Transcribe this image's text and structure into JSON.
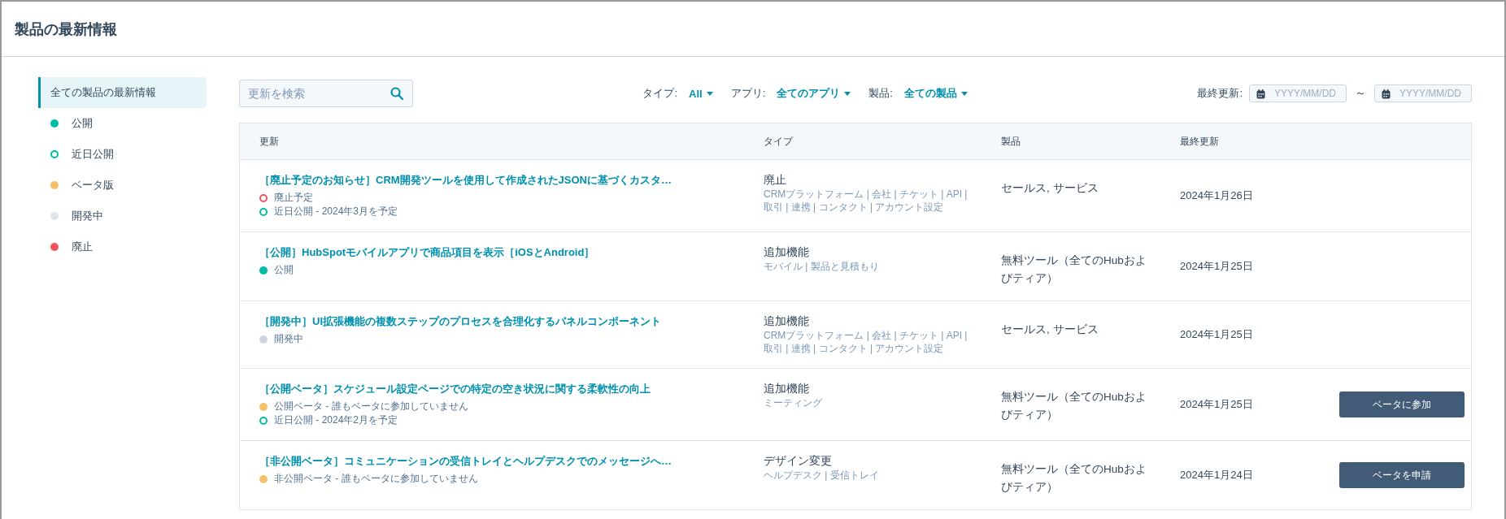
{
  "page": {
    "title": "製品の最新情報"
  },
  "sidebar": {
    "items": [
      {
        "label": "全ての製品の最新情報",
        "kind": "all",
        "selected": true
      },
      {
        "label": "公開",
        "kind": "filled",
        "color": "#00bda5",
        "selected": false
      },
      {
        "label": "近日公開",
        "kind": "ring",
        "color": "#00bda5",
        "selected": false
      },
      {
        "label": "ベータ版",
        "kind": "filled",
        "color": "#f5c26b",
        "selected": false
      },
      {
        "label": "開発中",
        "kind": "filled",
        "color": "#dfe3eb",
        "selected": false
      },
      {
        "label": "廃止",
        "kind": "filled",
        "color": "#f2545b",
        "selected": false
      }
    ]
  },
  "search": {
    "placeholder": "更新を検索"
  },
  "filters": [
    {
      "label": "タイプ:",
      "value": "All"
    },
    {
      "label": "アプリ:",
      "value": "全てのアプリ"
    },
    {
      "label": "製品:",
      "value": "全ての製品"
    }
  ],
  "date_range": {
    "label": "最終更新:",
    "separator": "～",
    "from": {
      "placeholder": "YYYY/MM/DD"
    },
    "to": {
      "placeholder": "YYYY/MM/DD"
    }
  },
  "table": {
    "columns": [
      "更新",
      "タイプ",
      "製品",
      "最終更新"
    ],
    "rows": [
      {
        "title": "［廃止予定のお知らせ］CRM開発ツールを使用して作成されたJSONに基づくカスタ…",
        "statuses": [
          {
            "text": "廃止予定",
            "kind": "ring",
            "color": "#f2545b"
          },
          {
            "text": "近日公開 - 2024年3月を予定",
            "kind": "ring",
            "color": "#00bda5"
          }
        ],
        "type": "廃止",
        "tags": "CRMプラットフォーム | 会社 | チケット | API | 取引 | 連携 | コンタクト | アカウント設定",
        "product": "セールス, サービス",
        "date": "2024年1月26日"
      },
      {
        "title": "［公開］HubSpotモバイルアプリで商品項目を表示［iOSとAndroid］",
        "statuses": [
          {
            "text": "公開",
            "kind": "filled",
            "color": "#00bda5"
          }
        ],
        "type": "追加機能",
        "tags": "モバイル | 製品と見積もり",
        "product": "無料ツール（全てのHubおよびティア）",
        "date": "2024年1月25日"
      },
      {
        "title": "［開発中］UI拡張機能の複数ステップのプロセスを合理化するパネルコンポーネント",
        "statuses": [
          {
            "text": "開発中",
            "kind": "filled",
            "color": "#cbd6e2"
          }
        ],
        "type": "追加機能",
        "tags": "CRMプラットフォーム | 会社 | チケット | API | 取引 | 連携 | コンタクト | アカウント設定",
        "product": "セールス, サービス",
        "date": "2024年1月25日"
      },
      {
        "title": "［公開ベータ］スケジュール設定ページでの特定の空き状況に関する柔軟性の向上",
        "statuses": [
          {
            "text": "公開ベータ - 誰もベータに参加していません",
            "kind": "filled",
            "color": "#f5c26b"
          },
          {
            "text": "近日公開 - 2024年2月を予定",
            "kind": "ring",
            "color": "#00bda5"
          }
        ],
        "type": "追加機能",
        "tags": "ミーティング",
        "product": "無料ツール（全てのHubおよびティア）",
        "date": "2024年1月25日",
        "action": "ベータに参加"
      },
      {
        "title": "［非公開ベータ］コミュニケーションの受信トレイとヘルプデスクでのメッセージへ…",
        "statuses": [
          {
            "text": "非公開ベータ - 誰もベータに参加していません",
            "kind": "filled",
            "color": "#f5c26b"
          }
        ],
        "type": "デザイン変更",
        "tags": "ヘルプデスク | 受信トレイ",
        "product": "無料ツール（全てのHubおよびティア）",
        "date": "2024年1月24日",
        "action": "ベータを申請"
      }
    ]
  }
}
